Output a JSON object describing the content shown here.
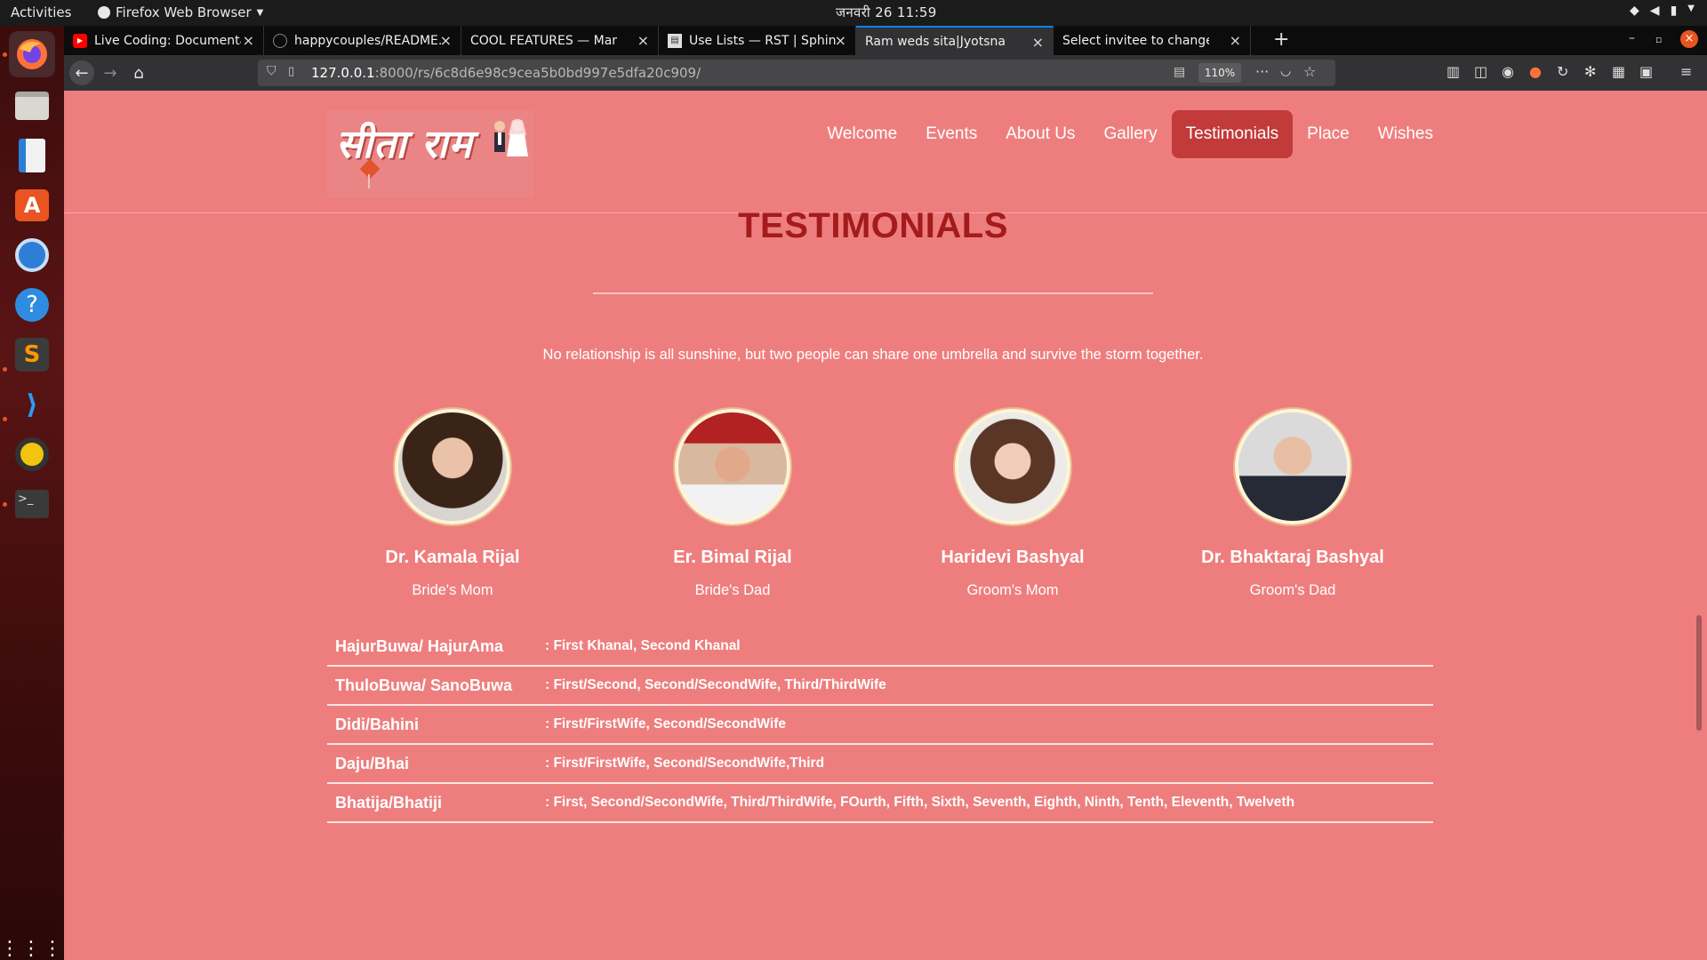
{
  "system": {
    "activities": "Activities",
    "app_menu": "Firefox Web Browser",
    "clock": "जनवरी 26  11:59"
  },
  "browser": {
    "tabs": [
      {
        "label": "Live Coding: Documentat",
        "icon": "youtube-icon",
        "active": false
      },
      {
        "label": "happycouples/README.",
        "icon": "github-icon",
        "active": false
      },
      {
        "label": "COOL FEATURES — Marriag",
        "icon": "",
        "active": false
      },
      {
        "label": "Use Lists — RST | Sphinx",
        "icon": "document-icon",
        "active": false
      },
      {
        "label": "Ram weds sita|Jyotsna",
        "icon": "",
        "active": true
      },
      {
        "label": "Select invitee to change | D",
        "icon": "",
        "active": false
      }
    ],
    "url_host": "127.0.0.1",
    "url_path": ":8000/rs/6c8d6e98c9cea5b0bd997e5dfa20c909/",
    "zoom": "110%"
  },
  "site": {
    "logo_text": "सीता राम",
    "nav": [
      {
        "label": "Welcome",
        "active": false
      },
      {
        "label": "Events",
        "active": false
      },
      {
        "label": "About Us",
        "active": false
      },
      {
        "label": "Gallery",
        "active": false
      },
      {
        "label": "Testimonials",
        "active": true
      },
      {
        "label": "Place",
        "active": false
      },
      {
        "label": "Wishes",
        "active": false
      }
    ],
    "section_title": "TESTIMONIALS",
    "quote": "No relationship is all sunshine, but two people can share one umbrella and survive the storm together.",
    "people": [
      {
        "name": "Dr. Kamala Rijal",
        "role": "Bride's Mom"
      },
      {
        "name": "Er. Bimal Rijal",
        "role": "Bride's Dad"
      },
      {
        "name": "Haridevi Bashyal",
        "role": "Groom's Mom"
      },
      {
        "name": "Dr. Bhaktaraj Bashyal",
        "role": "Groom's Dad"
      }
    ],
    "relations": [
      {
        "key": "HajurBuwa/ HajurAma",
        "value": ": First Khanal, Second Khanal"
      },
      {
        "key": "ThuloBuwa/ SanoBuwa",
        "value": ": First/Second, Second/SecondWife, Third/ThirdWife"
      },
      {
        "key": "Didi/Bahini",
        "value": ": First/FirstWife, Second/SecondWife"
      },
      {
        "key": "Daju/Bhai",
        "value": ": First/FirstWife, Second/SecondWife,Third"
      },
      {
        "key": "Bhatija/Bhatiji",
        "value": ": First, Second/SecondWife, Third/ThirdWife, FOurth, Fifth, Sixth, Seventh, Eighth, Ninth, Tenth, Eleventh, Twelveth"
      }
    ]
  },
  "colors": {
    "page_bg": "#ee7e7e",
    "title": "#a31b1b",
    "active_nav": "#c23a3a"
  }
}
